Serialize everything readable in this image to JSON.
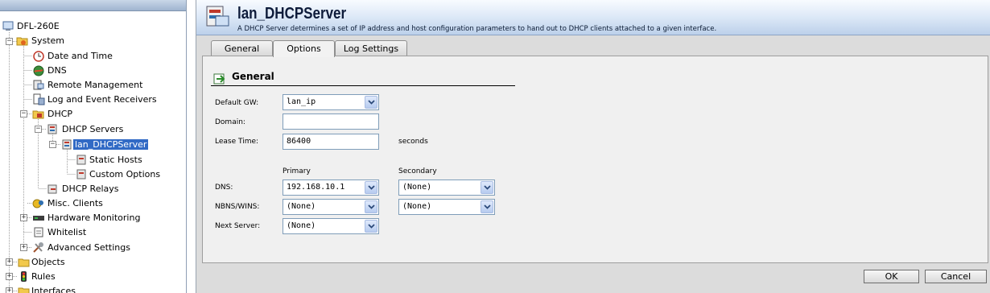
{
  "tree": {
    "items": [
      {
        "label": "DFL-260E",
        "icon": "device-icon"
      },
      {
        "label": "System",
        "icon": "system-folder-icon"
      },
      {
        "label": "Date and Time",
        "icon": "clock-icon"
      },
      {
        "label": "DNS",
        "icon": "globe-icon"
      },
      {
        "label": "Remote Management",
        "icon": "remote-management-icon"
      },
      {
        "label": "Log and Event Receivers",
        "icon": "log-receiver-icon"
      },
      {
        "label": "DHCP",
        "icon": "dhcp-folder-icon"
      },
      {
        "label": "DHCP Servers",
        "icon": "dhcp-servers-icon"
      },
      {
        "label": "lan_DHCPServer",
        "icon": "dhcp-server-icon"
      },
      {
        "label": "Static Hosts",
        "icon": "static-hosts-icon"
      },
      {
        "label": "Custom Options",
        "icon": "custom-options-icon"
      },
      {
        "label": "DHCP Relays",
        "icon": "dhcp-relay-icon"
      },
      {
        "label": "Misc. Clients",
        "icon": "misc-clients-icon"
      },
      {
        "label": "Hardware Monitoring",
        "icon": "hardware-monitoring-icon"
      },
      {
        "label": "Whitelist",
        "icon": "whitelist-icon"
      },
      {
        "label": "Advanced Settings",
        "icon": "advanced-settings-icon"
      },
      {
        "label": "Objects",
        "icon": "folder-icon"
      },
      {
        "label": "Rules",
        "icon": "rules-icon"
      },
      {
        "label": "Interfaces",
        "icon": "folder-icon"
      }
    ],
    "selected": "lan_DHCPServer"
  },
  "header": {
    "title": "lan_DHCPServer",
    "description": "A DHCP Server determines a set of IP address and host configuration parameters to hand out to DHCP clients attached to a given interface."
  },
  "tabs": [
    {
      "label": "General"
    },
    {
      "label": "Options",
      "active": true
    },
    {
      "label": "Log Settings"
    }
  ],
  "section": {
    "title": "General"
  },
  "form": {
    "default_gw": {
      "label": "Default GW:",
      "value": "lan_ip"
    },
    "domain": {
      "label": "Domain:",
      "value": ""
    },
    "lease_time": {
      "label": "Lease Time:",
      "value": "86400",
      "unit": "seconds"
    },
    "columns": {
      "primary": "Primary",
      "secondary": "Secondary"
    },
    "dns": {
      "label": "DNS:",
      "primary": "192.168.10.1",
      "secondary": "(None)"
    },
    "nbns": {
      "label": "NBNS/WINS:",
      "primary": "(None)",
      "secondary": "(None)"
    },
    "next_server": {
      "label": "Next Server:",
      "value": "(None)"
    }
  },
  "buttons": {
    "ok": "OK",
    "cancel": "Cancel"
  },
  "colors": {
    "selection": "#316ac5",
    "header_gradient_end": "#bcd0ea",
    "panel_bg": "#f0f0f0"
  }
}
